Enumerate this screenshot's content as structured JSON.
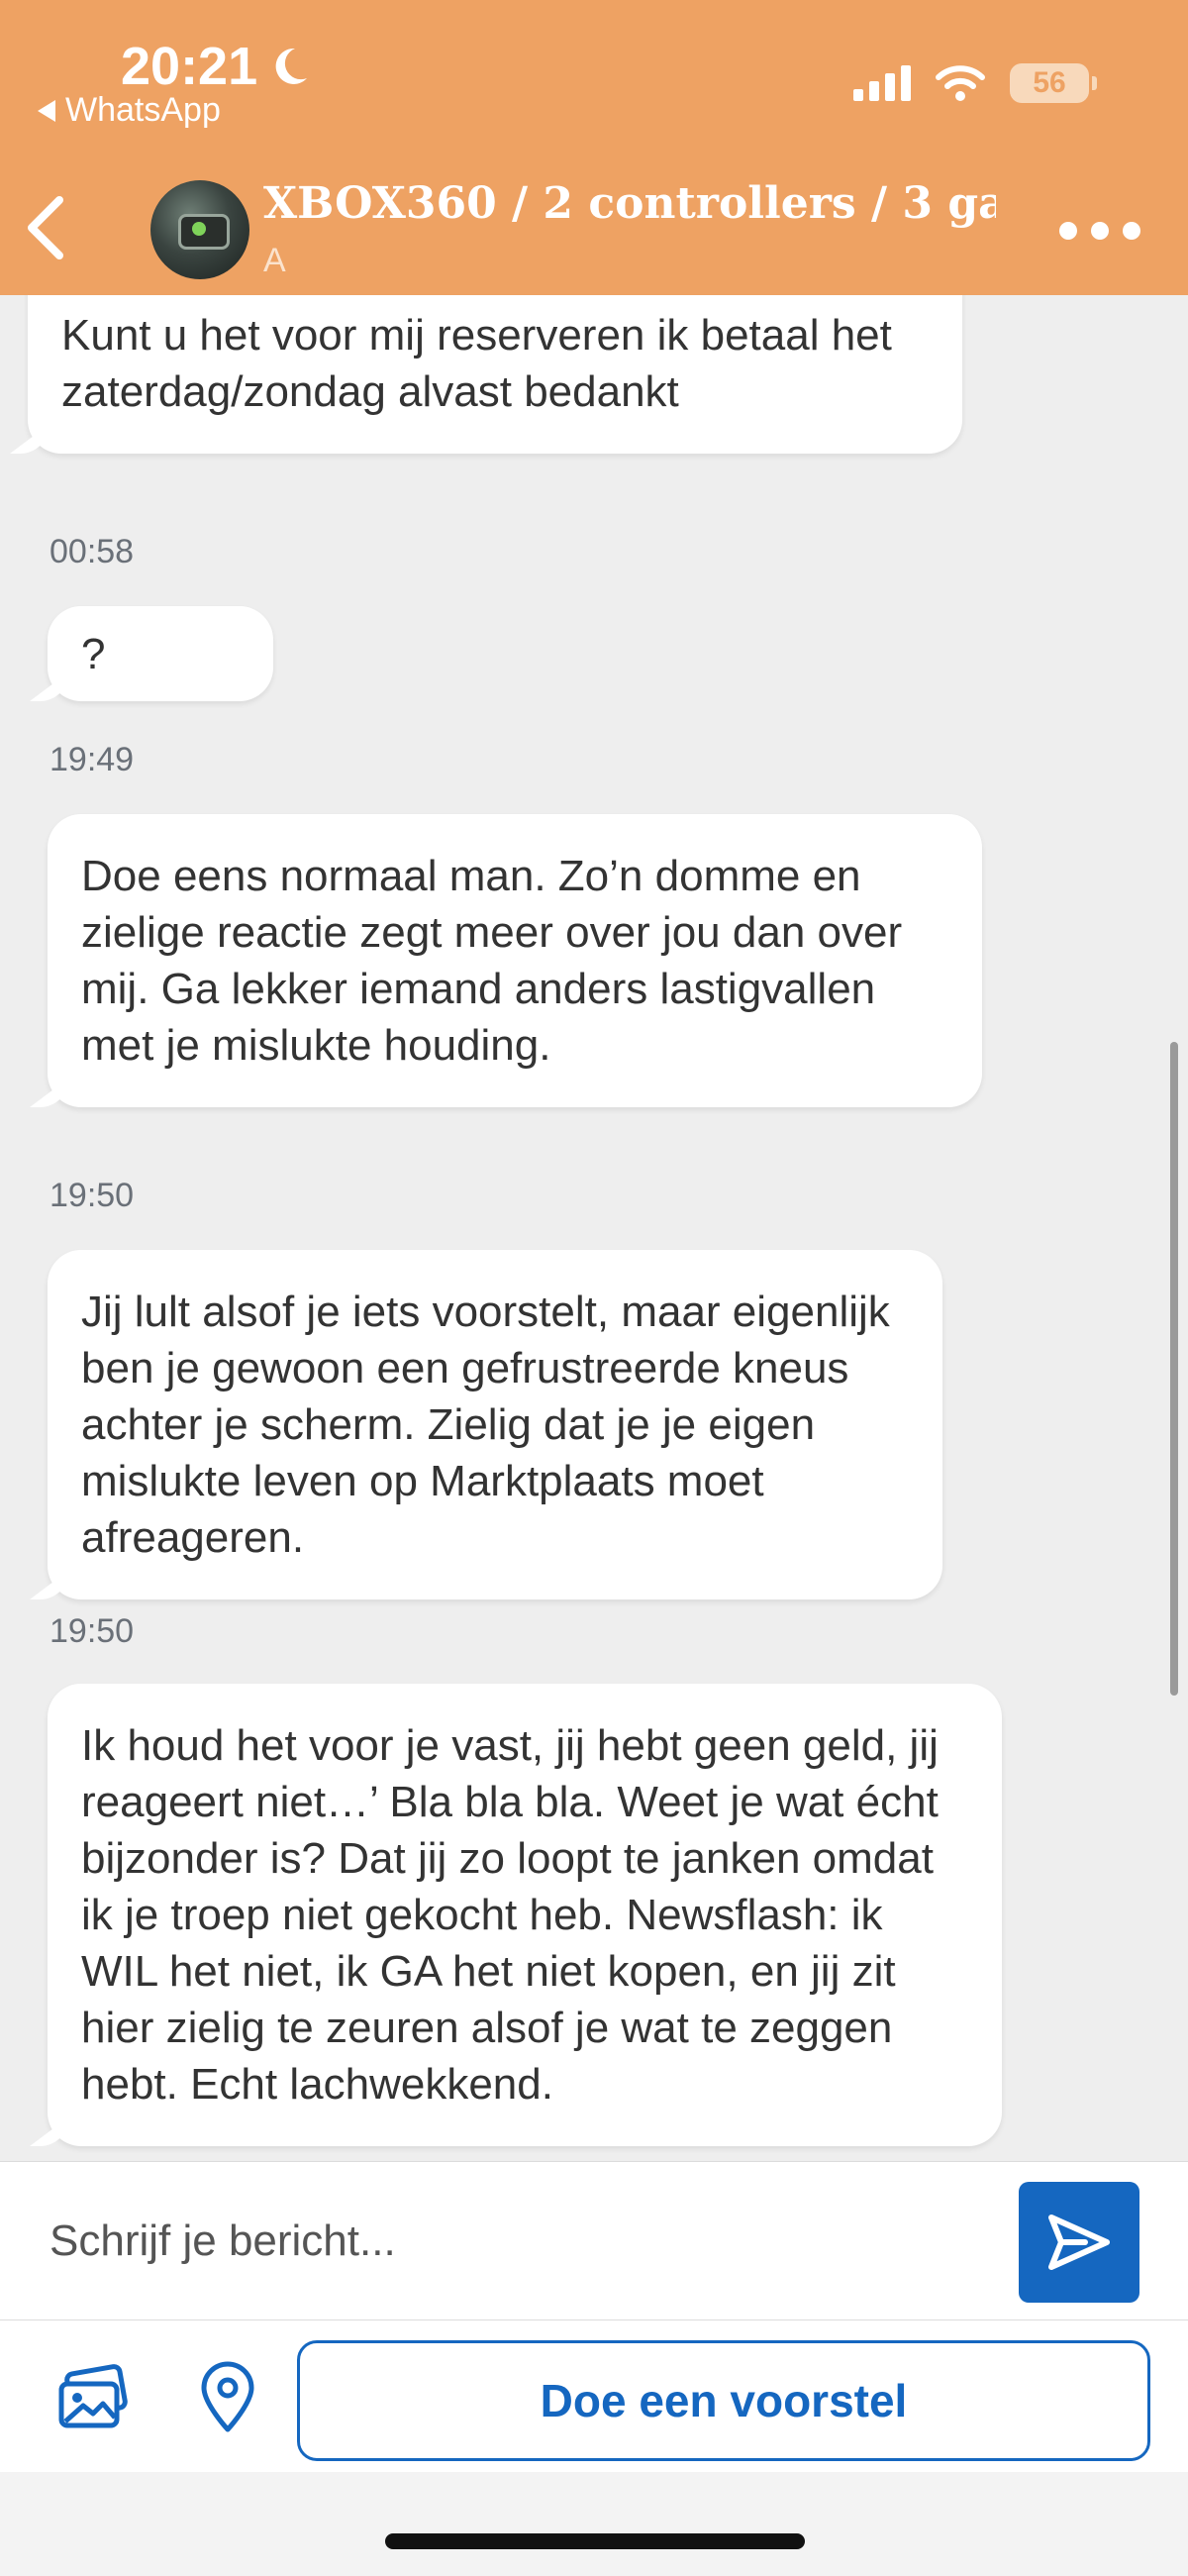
{
  "status_bar": {
    "time": "20:21",
    "back_app": "WhatsApp",
    "battery": "56"
  },
  "header": {
    "title": "XBOX360 / 2 controllers / 3 gam...",
    "subtitle": "A"
  },
  "messages": [
    {
      "text": "Kunt u het voor mij reserveren ik betaal het zaterdag/zondag alvast bedankt",
      "time": "00:58"
    },
    {
      "text": "?",
      "time": "19:49"
    },
    {
      "text": "Doe eens normaal man. Zo’n domme en zielige reactie zegt meer over jou dan over mij. Ga lekker iemand anders lastigvallen met je mislukte houding.",
      "time": "19:50"
    },
    {
      "text": "Jij lult alsof je iets voorstelt, maar eigenlijk ben je gewoon een gefrustreerde kneus achter je scherm. Zielig dat je je eigen mislukte leven op Marktplaats moet afreageren.",
      "time": "19:50"
    },
    {
      "text": "Ik houd het voor je vast, jij hebt geen geld, jij reageert niet…’ Bla bla bla. Weet je wat écht bijzonder is? Dat jij zo loopt te janken omdat ik je troep niet gekocht heb. Newsflash: ik WIL het niet, ik GA het niet kopen, en jij zit hier zielig te zeuren alsof je wat te zeggen hebt. Echt lachwekkend."
    }
  ],
  "composer": {
    "placeholder": "Schrijf je bericht..."
  },
  "toolbar": {
    "offer_label": "Doe een voorstel"
  },
  "colors": {
    "header": "#eea263",
    "accent": "#1567c0",
    "chat_background": "#eeeeee"
  },
  "icons": [
    "moon-icon",
    "signal-icon",
    "wifi-icon",
    "battery-icon",
    "back-chevron-icon",
    "more-icon",
    "send-icon",
    "photos-icon",
    "location-pin-icon"
  ]
}
